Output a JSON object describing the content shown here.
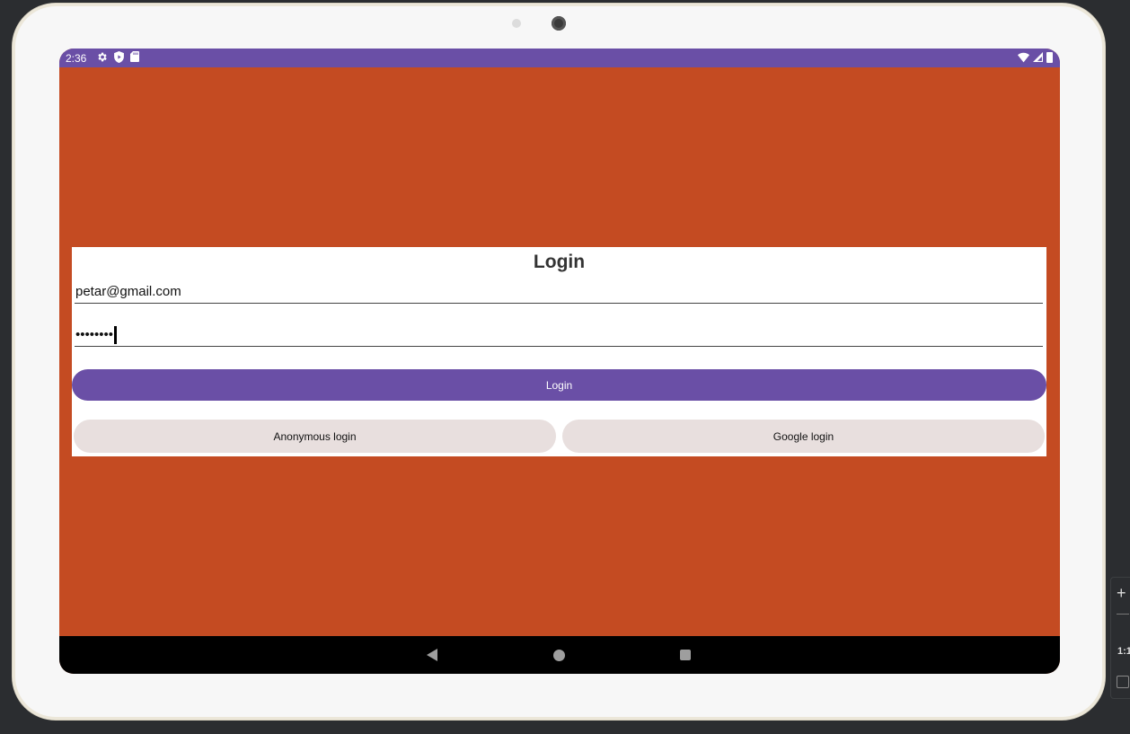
{
  "status_bar": {
    "time": "2:36",
    "left_icons": [
      "gear-icon",
      "shield-icon",
      "sd-card-icon"
    ],
    "right_icons": [
      "wifi-icon",
      "signal-icon",
      "battery-icon"
    ]
  },
  "login_form": {
    "title": "Login",
    "email_value": "petar@gmail.com",
    "password_value": "••••••••",
    "login_button": "Login",
    "anonymous_button": "Anonymous login",
    "google_button": "Google login"
  },
  "nav_bar": {
    "buttons": [
      "back",
      "home",
      "recents"
    ]
  },
  "emulator_tools": {
    "zoom_in": "+",
    "ratio": "1:1"
  },
  "colors": {
    "app_background": "#c44b22",
    "status_bar": "#6a4fa6",
    "primary_button": "#6a4fa6",
    "secondary_button": "#e8dfde"
  }
}
